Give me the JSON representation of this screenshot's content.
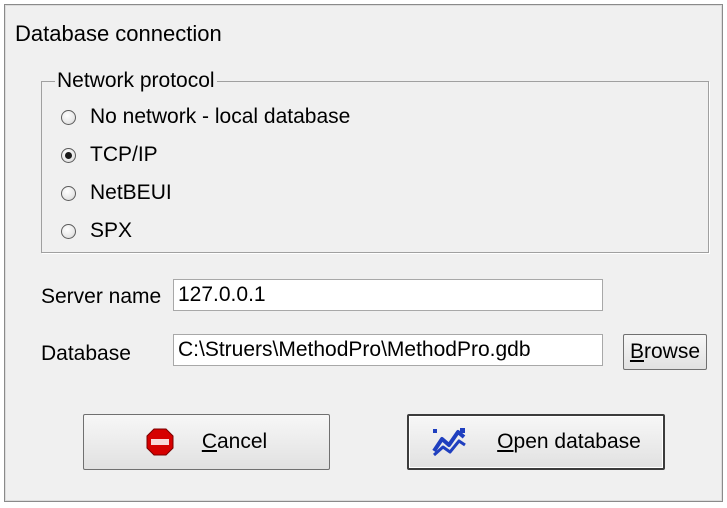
{
  "window": {
    "title": "Database connection"
  },
  "network": {
    "legend": "Network protocol",
    "options": [
      {
        "label": "No network - local database",
        "checked": false
      },
      {
        "label": "TCP/IP",
        "checked": true
      },
      {
        "label": "NetBEUI",
        "checked": false
      },
      {
        "label": "SPX",
        "checked": false
      }
    ]
  },
  "server": {
    "label": "Server name",
    "value": "127.0.0.1"
  },
  "database": {
    "label": "Database",
    "value": "C:\\Struers\\MethodPro\\MethodPro.gdb",
    "browse_label": "Browse"
  },
  "buttons": {
    "cancel_label": "Cancel",
    "open_label": "Open database"
  },
  "icons": {
    "cancel": "stop-sign-icon",
    "open": "database-chart-icon"
  },
  "colors": {
    "stop_red": "#d60000",
    "chart_blue": "#1f3fbf"
  }
}
